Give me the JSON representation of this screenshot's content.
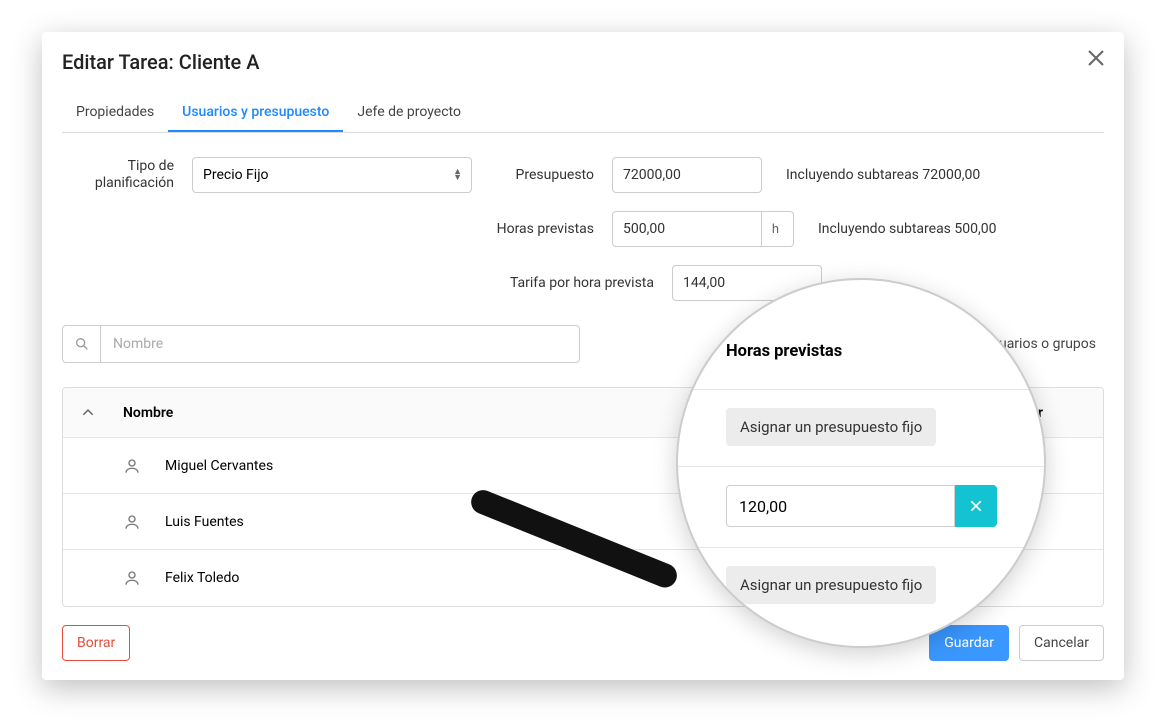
{
  "dialog": {
    "title": "Editar Tarea: Cliente A"
  },
  "tabs": {
    "propiedades": "Propiedades",
    "usuarios": "Usuarios y presupuesto",
    "jefe": "Jefe de proyecto"
  },
  "form": {
    "tipo_label_1": "Tipo de",
    "tipo_label_2": "planificación",
    "tipo_value": "Precio Fijo",
    "presupuesto_label": "Presupuesto",
    "presupuesto_value": "72000,00",
    "presupuesto_side": "Incluyendo subtareas 72000,00",
    "horas_label": "Horas previstas",
    "horas_value": "500,00",
    "horas_unit": "h",
    "horas_side": "Incluyendo subtareas 500,00",
    "tarifa_label": "Tarifa por hora prevista",
    "tarifa_value": "144,00"
  },
  "search": {
    "placeholder": "Nombre",
    "add_users": "usuarios o grupos"
  },
  "table": {
    "col_name": "Nombre",
    "col_hours": "Horas previstas",
    "col_actions": "ear",
    "rows": [
      {
        "name": "Miguel Cervantes"
      },
      {
        "name": "Luis Fuentes"
      },
      {
        "name": "Felix Toledo"
      }
    ]
  },
  "footer": {
    "delete": "Borrar",
    "save": "Guardar",
    "cancel": "Cancelar"
  },
  "magnifier": {
    "title": "Horas previstas",
    "assign_1": "Asignar un presupuesto fijo",
    "hours_value": "120,00",
    "assign_2": "Asignar un presupuesto fijo"
  }
}
